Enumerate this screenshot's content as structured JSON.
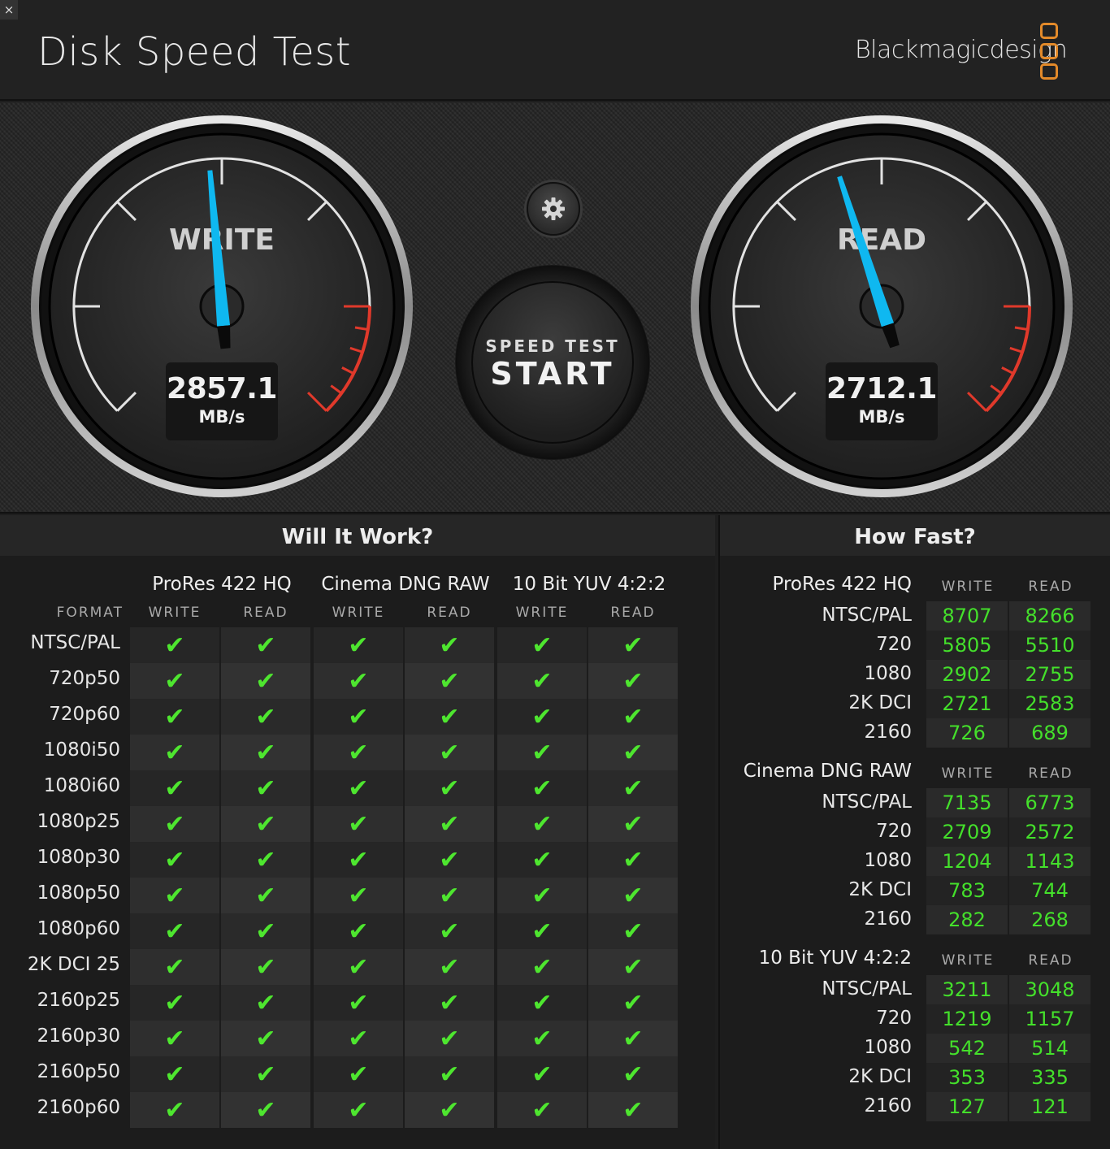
{
  "header": {
    "close_label": "×",
    "title": "Disk Speed Test",
    "brand": "Blackmagicdesign"
  },
  "colors": {
    "accent_needle": "#0fb8f0",
    "redline": "#e0392b",
    "check_green": "#4ee62f",
    "number_green": "#44e02b",
    "brand_orange": "#e38a2a"
  },
  "gauges": {
    "write": {
      "label": "WRITE",
      "value": "2857.1",
      "unit": "MB/s",
      "needle_angle_deg": -5
    },
    "read": {
      "label": "READ",
      "value": "2712.1",
      "unit": "MB/s",
      "needle_angle_deg": -18
    }
  },
  "controls": {
    "settings_icon": "gear-icon",
    "start_sub": "SPEED TEST",
    "start_main": "START"
  },
  "will_it_work": {
    "title": "Will It Work?",
    "format_label": "FORMAT",
    "groups": [
      "ProRes 422 HQ",
      "Cinema DNG RAW",
      "10 Bit YUV 4:2:2"
    ],
    "write_label": "WRITE",
    "read_label": "READ",
    "rows": [
      "NTSC/PAL",
      "720p50",
      "720p60",
      "1080i50",
      "1080i60",
      "1080p25",
      "1080p30",
      "1080p50",
      "1080p60",
      "2K DCI 25",
      "2160p25",
      "2160p30",
      "2160p50",
      "2160p60"
    ],
    "check_mark": "✔"
  },
  "how_fast": {
    "title": "How Fast?",
    "write_label": "WRITE",
    "read_label": "READ",
    "groups": [
      {
        "name": "ProRes 422 HQ",
        "rows": [
          {
            "label": "NTSC/PAL",
            "write": "8707",
            "read": "8266"
          },
          {
            "label": "720",
            "write": "5805",
            "read": "5510"
          },
          {
            "label": "1080",
            "write": "2902",
            "read": "2755"
          },
          {
            "label": "2K DCI",
            "write": "2721",
            "read": "2583"
          },
          {
            "label": "2160",
            "write": "726",
            "read": "689"
          }
        ]
      },
      {
        "name": "Cinema DNG RAW",
        "rows": [
          {
            "label": "NTSC/PAL",
            "write": "7135",
            "read": "6773"
          },
          {
            "label": "720",
            "write": "2709",
            "read": "2572"
          },
          {
            "label": "1080",
            "write": "1204",
            "read": "1143"
          },
          {
            "label": "2K DCI",
            "write": "783",
            "read": "744"
          },
          {
            "label": "2160",
            "write": "282",
            "read": "268"
          }
        ]
      },
      {
        "name": "10 Bit YUV 4:2:2",
        "rows": [
          {
            "label": "NTSC/PAL",
            "write": "3211",
            "read": "3048"
          },
          {
            "label": "720",
            "write": "1219",
            "read": "1157"
          },
          {
            "label": "1080",
            "write": "542",
            "read": "514"
          },
          {
            "label": "2K DCI",
            "write": "353",
            "read": "335"
          },
          {
            "label": "2160",
            "write": "127",
            "read": "121"
          }
        ]
      }
    ]
  }
}
